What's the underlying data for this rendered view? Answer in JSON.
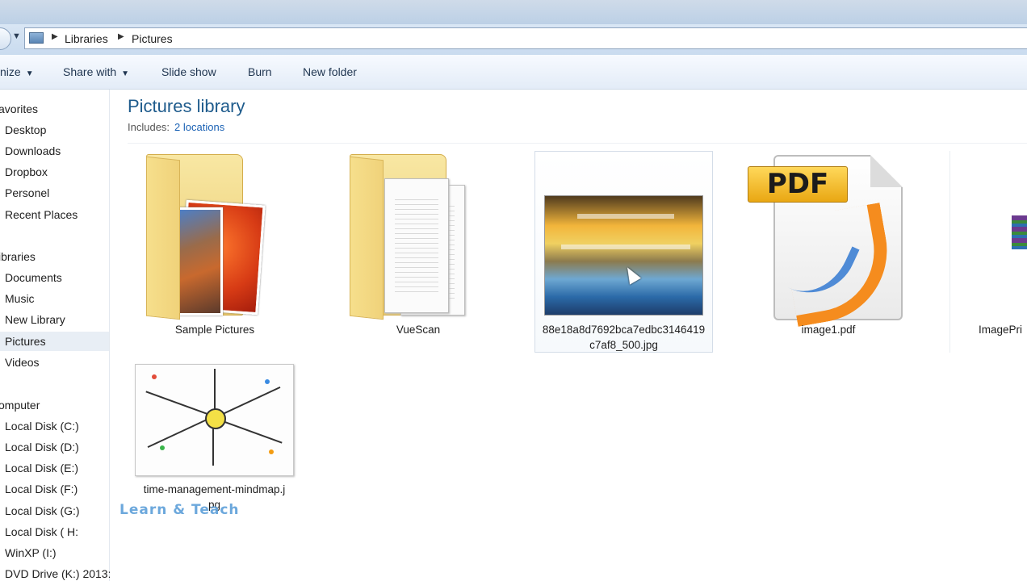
{
  "address": {
    "crumbs": [
      "Libraries",
      "Pictures"
    ]
  },
  "toolbar": {
    "organize": "nize",
    "share": "Share with",
    "slideshow": "Slide show",
    "burn": "Burn",
    "new_folder": "New folder"
  },
  "nav": {
    "favorites_header": "avorites",
    "favorites": [
      "Desktop",
      "Downloads",
      "Dropbox",
      "Personel",
      "Recent Places"
    ],
    "libraries_header": "ibraries",
    "libraries": [
      "Documents",
      "Music",
      "New Library",
      "Pictures",
      "Videos"
    ],
    "computer_header": "omputer",
    "computer": [
      "Local Disk (C:)",
      "Local Disk (D:)",
      "Local Disk (E:)",
      "Local Disk (F:)",
      "Local Disk (G:)",
      "Local Disk ( H:",
      "WinXP (I:)",
      "DVD Drive (K:) 2013:"
    ]
  },
  "library": {
    "title": "Pictures library",
    "includes_label": "Includes:",
    "locations": "2 locations"
  },
  "items": [
    {
      "label": "Sample Pictures"
    },
    {
      "label": "VueScan"
    },
    {
      "label_line1": "88e18a8d7692bca7edbc3146419",
      "label_line2": "c7af8_500.jpg"
    },
    {
      "label": "image1.pdf",
      "badge": "PDF"
    },
    {
      "label": "ImagePri"
    },
    {
      "label_line1": "time-management-mindmap.j",
      "label_line2": "pg"
    }
  ],
  "watermark": "Learn & Teach"
}
